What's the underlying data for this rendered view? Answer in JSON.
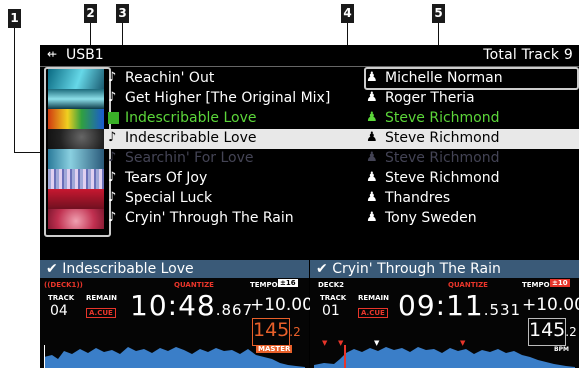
{
  "callouts": [
    "1",
    "2",
    "3",
    "4",
    "5"
  ],
  "header": {
    "source": "USB1",
    "usb_icon": "usb-icon",
    "total": "Total Track 9"
  },
  "colors": {
    "header_bar": "#3a5a78",
    "selected_row": "#e8e8e8",
    "playing_green": "#5cd63a",
    "accent_red": "#e8352a",
    "master_orange": "#e8602a"
  },
  "tracks": [
    {
      "title": "Reachin' Out",
      "artist": "Michelle Norman",
      "state": "normal"
    },
    {
      "title": "Get Higher [The Original Mix]",
      "artist": "Roger Theria",
      "state": "normal"
    },
    {
      "title": "Indescribable Love",
      "artist": "Steve Richmond",
      "state": "playing"
    },
    {
      "title": "Indescribable Love",
      "artist": "Steve Richmond",
      "state": "selected"
    },
    {
      "title": "Searchin' For Love",
      "artist": "Steve Richmond",
      "state": "dim"
    },
    {
      "title": "Tears Of Joy",
      "artist": "Steve Richmond",
      "state": "normal"
    },
    {
      "title": "Special Luck",
      "artist": "Thandres",
      "state": "normal"
    },
    {
      "title": "Cryin' Through The Rain",
      "artist": "Tony Sweden",
      "state": "normal"
    }
  ],
  "deck1": {
    "title": "Indescribable Love",
    "label": "DECK1",
    "track_label": "TRACK",
    "track": "04",
    "remain_label": "REMAIN",
    "acue": "A.CUE",
    "quantize": "QUANTIZE",
    "time_main": "10:48",
    "time_ms": ".867",
    "tempo_label": "TEMPO",
    "tempo_range": "±16",
    "tempo": "+10.00",
    "tempo_unit": "%",
    "bpm_main": "145",
    "bpm_dec": ".2",
    "master": "MASTER"
  },
  "deck2": {
    "title": "Cryin' Through The Rain",
    "label": "DECK2",
    "track_label": "TRACK",
    "track": "01",
    "remain_label": "REMAIN",
    "acue": "A.CUE",
    "quantize": "QUANTIZE",
    "time_main": "09:11",
    "time_ms": ".531",
    "tempo_label": "TEMPO",
    "tempo_range": "±10",
    "tempo": "+10.00",
    "tempo_unit": "%",
    "bpm_main": "145",
    "bpm_dec": ".2",
    "bpm_unit": "BPM"
  }
}
